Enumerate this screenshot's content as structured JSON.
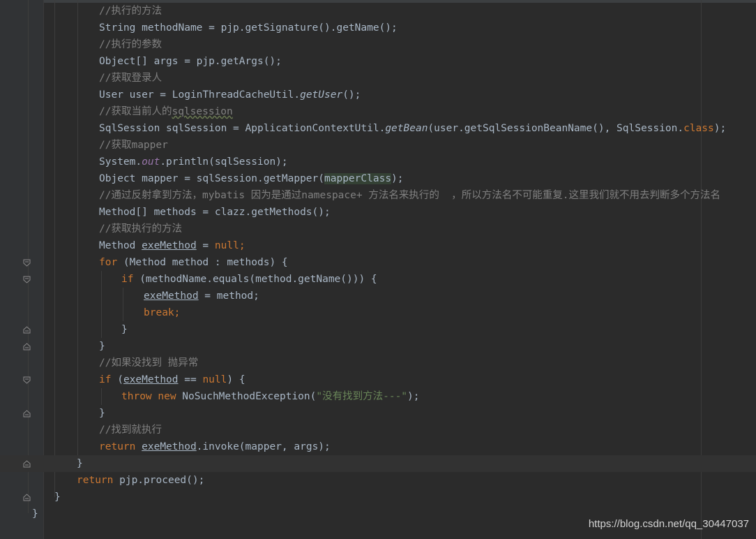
{
  "editor": {
    "lines": {
      "c1": "//执行的方法",
      "l2": {
        "a": "String methodName = pjp.getSignature().getName();"
      },
      "c3": "//执行的参数",
      "l4": {
        "a": "Object[] args = pjp.getArgs();"
      },
      "c5": "//获取登录人",
      "l6": {
        "a": "User user = LoginThreadCacheUtil.",
        "b": "getUser",
        "c": "();"
      },
      "c7": "//获取当前人的",
      "c7b": "sqlsession",
      "l8": {
        "a": "SqlSession sqlSession = ApplicationContextUtil.",
        "b": "getBean",
        "c": "(user.getSqlSessionBeanName(), SqlSession.",
        "d": "class",
        "e": ");"
      },
      "c9": "//获取mapper",
      "l10": {
        "a": "System.",
        "b": "out",
        "c": ".println(sqlSession);"
      },
      "l11": {
        "a": "Object mapper = sqlSession.getMapper(",
        "b": "mapperClass",
        "c": ");"
      },
      "c12": "//通过反射拿到方法，mybatis 因为是通过namespace+ 方法名来执行的  ，所以方法名不可能重复.这里我们就不用去判断多个方法名",
      "l13": {
        "a": "Method[] methods = clazz.getMethods();"
      },
      "c14": "//获取执行的方法",
      "l15": {
        "a": "Method ",
        "b": "exeMethod",
        "c": " = ",
        "d": "null",
        "e": ";"
      },
      "l16": {
        "a": "for",
        "b": " (Method method : methods) {"
      },
      "l17": {
        "a": "if",
        "b": " (methodName.equals(method.getName())) {"
      },
      "l18": {
        "a": "exeMethod",
        "b": " = method;"
      },
      "l19": {
        "a": "break",
        "b": ";"
      },
      "l20": "}",
      "l21": "}",
      "c22": "//如果没找到 抛异常",
      "l23": {
        "a": "if",
        "b": " (",
        "c": "exeMethod",
        "d": " == ",
        "e": "null",
        "f": ") {"
      },
      "l24": {
        "a": "throw new",
        "b": " NoSuchMethodException(",
        "c": "\"没有找到方法---\"",
        "d": ");"
      },
      "l25": "}",
      "c26": "//找到就执行",
      "l27": {
        "a": "return",
        "b": " ",
        "c": "exeMethod",
        "d": ".invoke(mapper, args);"
      },
      "l28": "}",
      "l29": {
        "a": "return",
        "b": " pjp.proceed();"
      },
      "l30": "}",
      "l31": "}"
    },
    "colors": {
      "background": "#2b2b2b",
      "keyword": "#cc7832",
      "comment": "#808080",
      "string": "#6a8759",
      "field": "#9876aa",
      "text": "#a9b7c6"
    }
  },
  "watermark": "https://blog.csdn.net/qq_30447037"
}
